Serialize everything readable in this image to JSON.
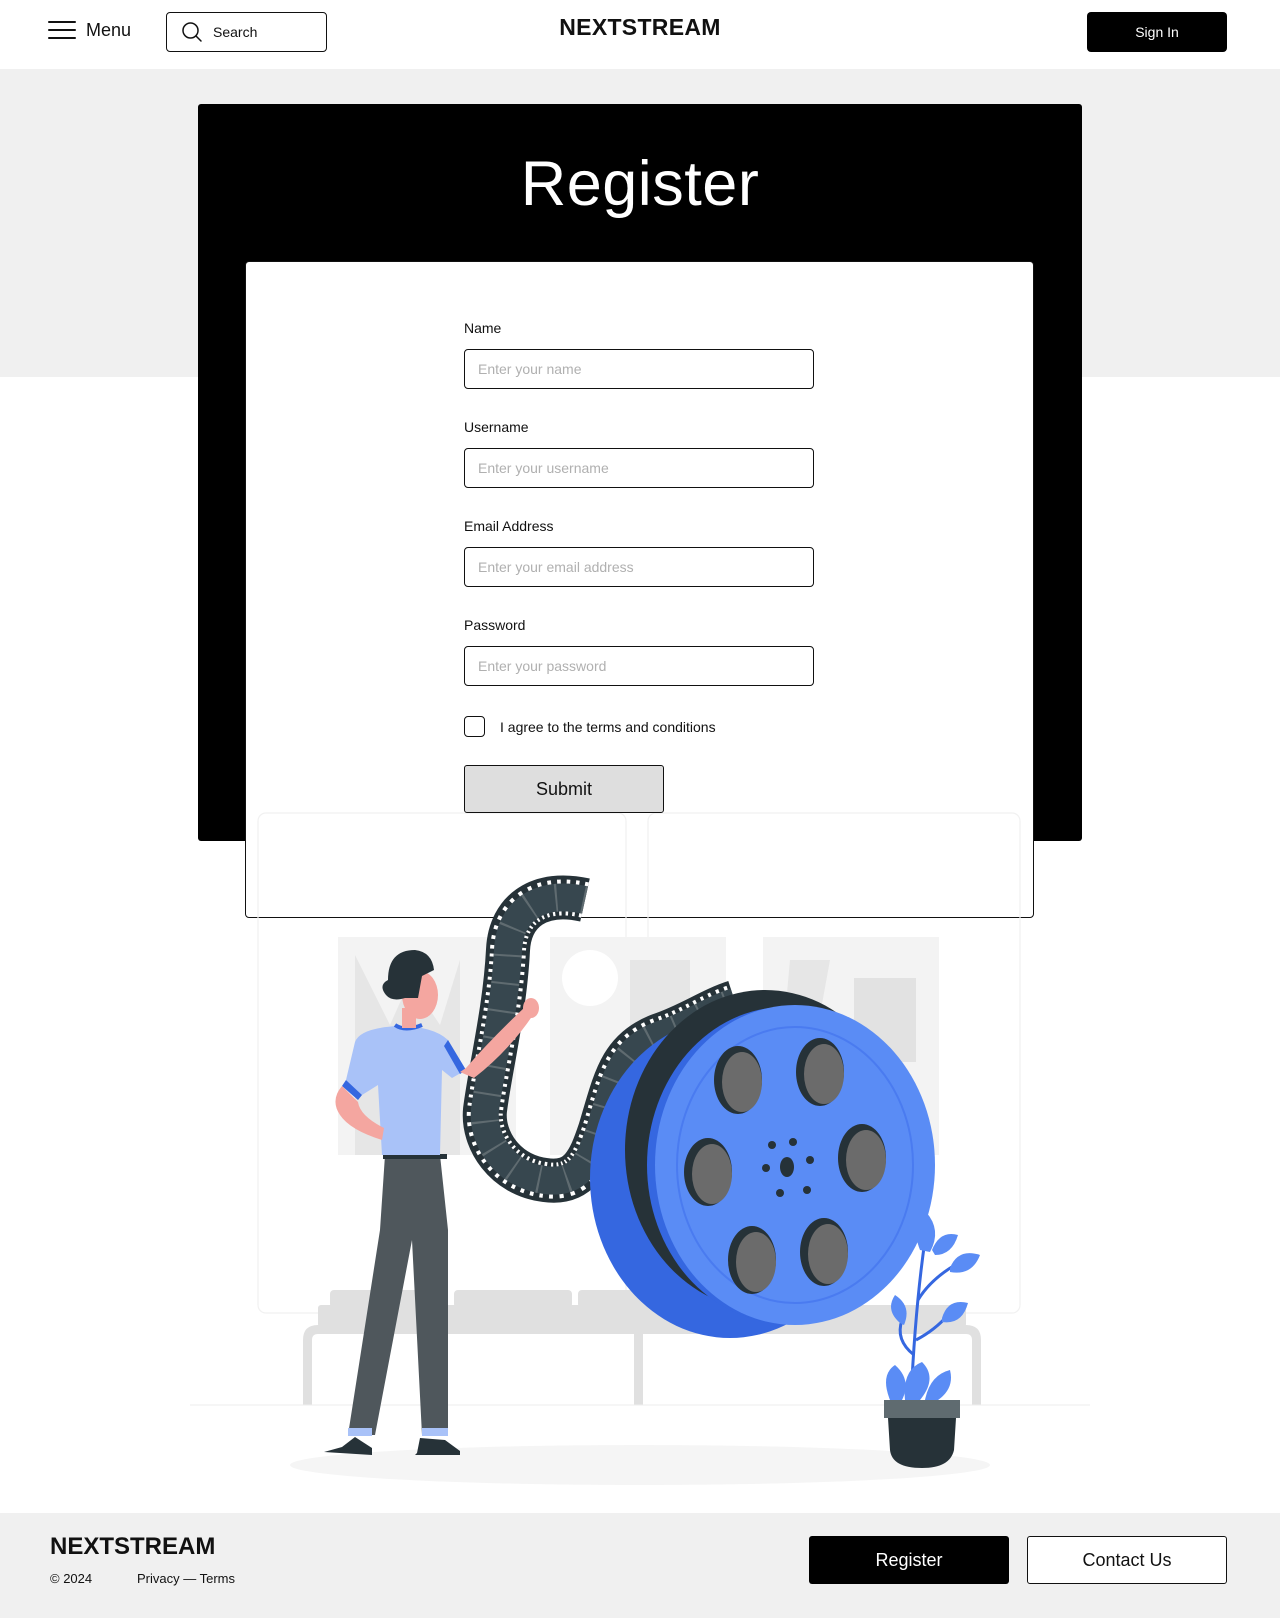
{
  "header": {
    "menu_label": "Menu",
    "menu_icon": "hamburger-menu-icon",
    "search_label": "Search",
    "search_icon": "search-icon",
    "brand": "NEXTSTREAM",
    "signin_label": "Sign In"
  },
  "main": {
    "title": "Register",
    "form": {
      "fields": [
        {
          "label": "Name",
          "placeholder": "Enter your name",
          "value": ""
        },
        {
          "label": "Username",
          "placeholder": "Enter your username",
          "value": ""
        },
        {
          "label": "Email Address",
          "placeholder": "Enter your email address",
          "value": ""
        },
        {
          "label": "Password",
          "placeholder": "Enter your password",
          "value": ""
        }
      ],
      "agree_label": "I agree to the terms and conditions",
      "agree_checked": false,
      "submit_label": "Submit"
    },
    "illustration": "person-with-film-reel-illustration"
  },
  "footer": {
    "brand": "NEXTSTREAM",
    "copyright": "© 2024",
    "links": "Privacy — Terms",
    "register_label": "Register",
    "contact_label": "Contact Us"
  },
  "colors": {
    "accent_blue": "#5a8cf5",
    "dark_blue": "#3567e0",
    "light_blue": "#a9c2f8",
    "dark": "#263238",
    "black": "#000000",
    "gray_bg": "#f0f0f0"
  }
}
